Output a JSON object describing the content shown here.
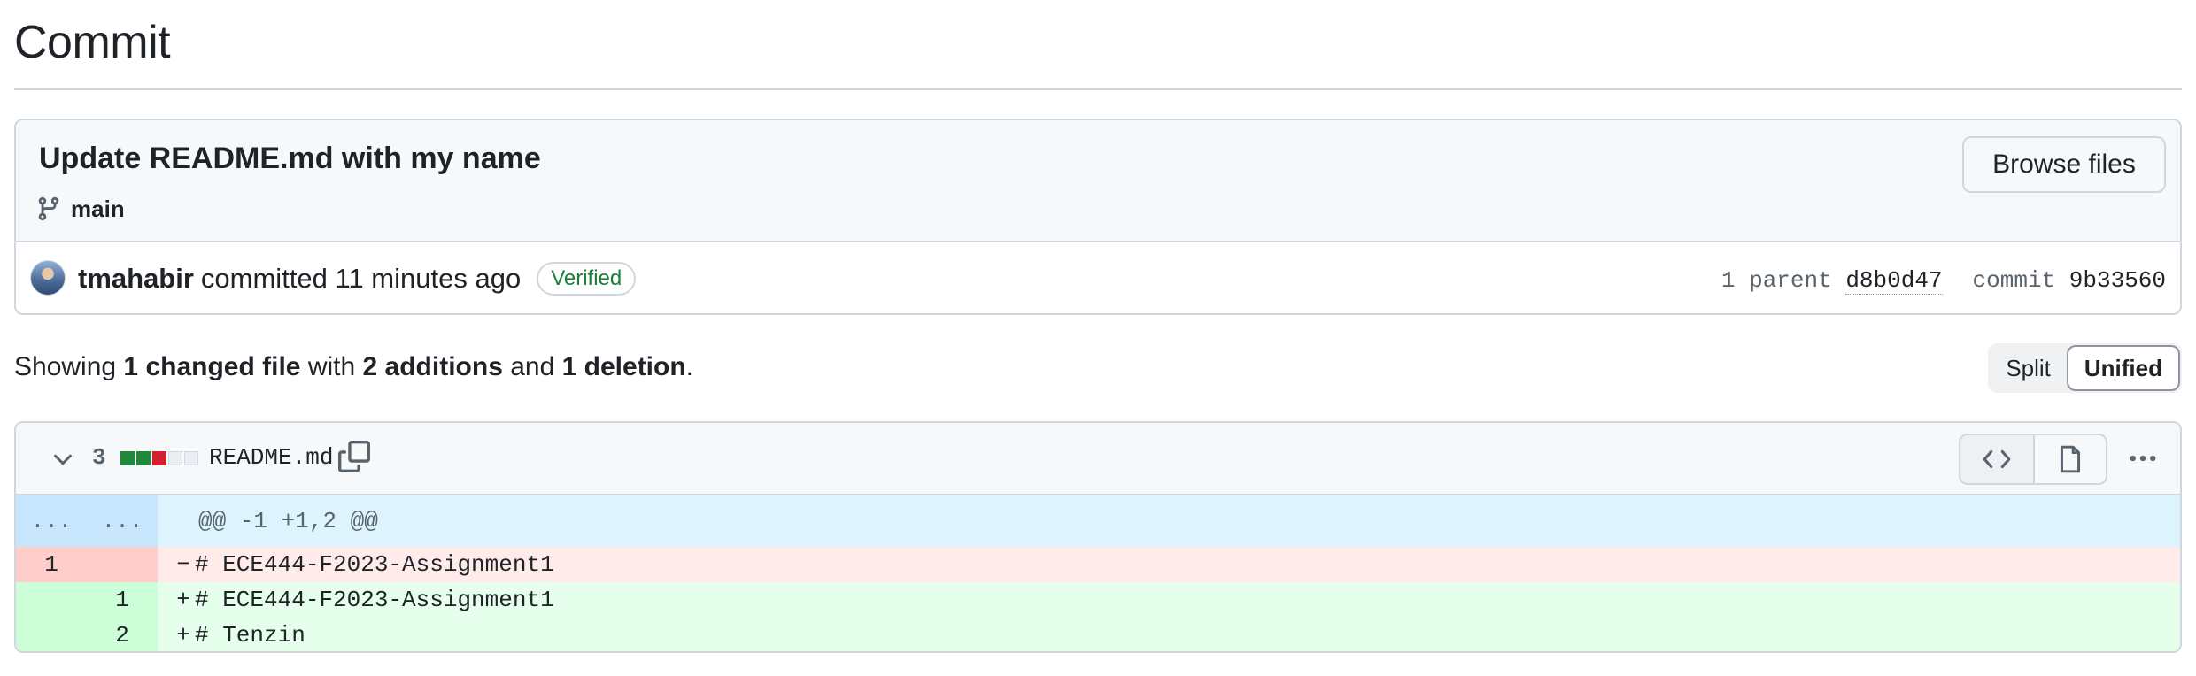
{
  "page": {
    "title": "Commit"
  },
  "commit": {
    "message": "Update README.md with my name",
    "branch": "main",
    "browse_label": "Browse files",
    "author": "tmahabir",
    "action": "committed 11 minutes ago",
    "verified_label": "Verified",
    "parent_label": "1 parent",
    "parent_sha": "d8b0d47",
    "commit_label": "commit",
    "commit_sha": "9b33560"
  },
  "summary": {
    "prefix": "Showing",
    "changed": "1 changed file",
    "with": "with",
    "additions": "2 additions",
    "and": "and",
    "deletions": "1 deletion",
    "suffix": "."
  },
  "view_toggle": {
    "split": "Split",
    "unified": "Unified",
    "selected": "Unified"
  },
  "file": {
    "changes_count": "3",
    "diffstat": [
      "add",
      "add",
      "del",
      "neu",
      "neu"
    ],
    "name": "README.md",
    "hunk": {
      "old_gutter": "...",
      "new_gutter": "...",
      "header": "@@ -1 +1,2 @@"
    },
    "lines": [
      {
        "type": "del",
        "old": "1",
        "new": "",
        "sign": "−",
        "code": "# ECE444-F2023-Assignment1"
      },
      {
        "type": "add",
        "old": "",
        "new": "1",
        "sign": "+",
        "code": "# ECE444-F2023-Assignment1"
      },
      {
        "type": "add",
        "old": "",
        "new": "2",
        "sign": "+",
        "code": "# Tenzin"
      }
    ]
  },
  "colors": {
    "addition": "#1f883d",
    "deletion": "#cf222e",
    "verified": "#1a7f37",
    "hunk_bg": "#ddf4ff"
  }
}
